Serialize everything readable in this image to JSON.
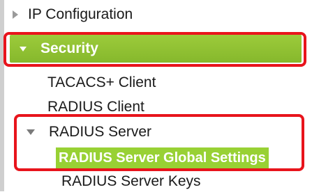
{
  "nav": {
    "ip_configuration": "IP Configuration",
    "security": "Security",
    "tacacs_client": "TACACS+ Client",
    "radius_client": "RADIUS Client",
    "radius_server": "RADIUS Server",
    "radius_server_global_settings": "RADIUS Server Global Settings",
    "radius_server_keys": "RADIUS Server Keys"
  },
  "colors": {
    "accent_green": "#98d134",
    "highlight_red": "#e8141c"
  },
  "icons": {
    "collapsed": "triangle-right-icon",
    "expanded": "triangle-down-icon"
  }
}
